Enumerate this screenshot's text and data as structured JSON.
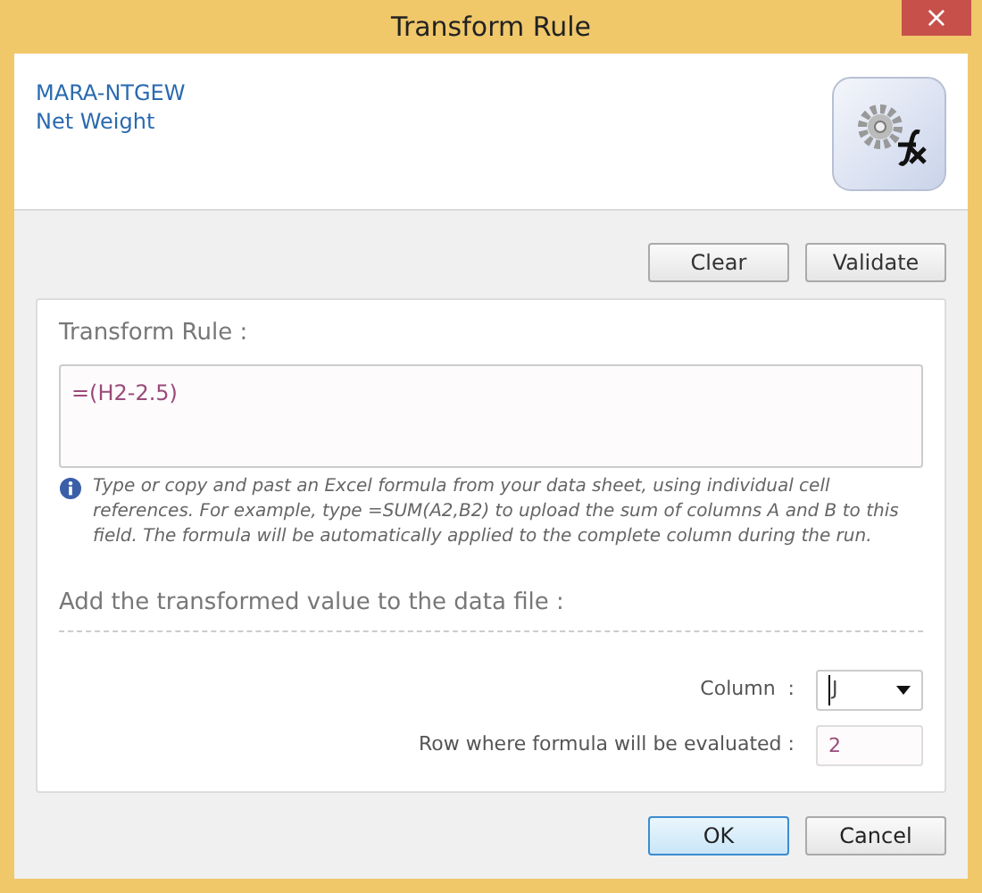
{
  "window": {
    "title": "Transform Rule",
    "close": "×"
  },
  "header": {
    "code": "MARA-NTGEW",
    "name": "Net Weight"
  },
  "toolbar": [
    "Clear",
    "Validate"
  ],
  "rule": {
    "label": "Transform Rule :",
    "value": "=(H2-2.5)",
    "info": "Type or copy and past an Excel formula from your data sheet, using individual cell references. For example, type =SUM(A2,B2) to upload the sum of columns A and B to this field. The formula will be automatically applied to the complete column during the run."
  },
  "target": {
    "heading": "Add the transformed value to the data file :",
    "column_label": "Column  :",
    "column_value": "J",
    "row_label": "Row where formula will be evaluated :",
    "row_value": "2"
  },
  "buttons": [
    {
      "label": "OK",
      "default": true
    },
    {
      "label": "Cancel",
      "default": false
    }
  ]
}
